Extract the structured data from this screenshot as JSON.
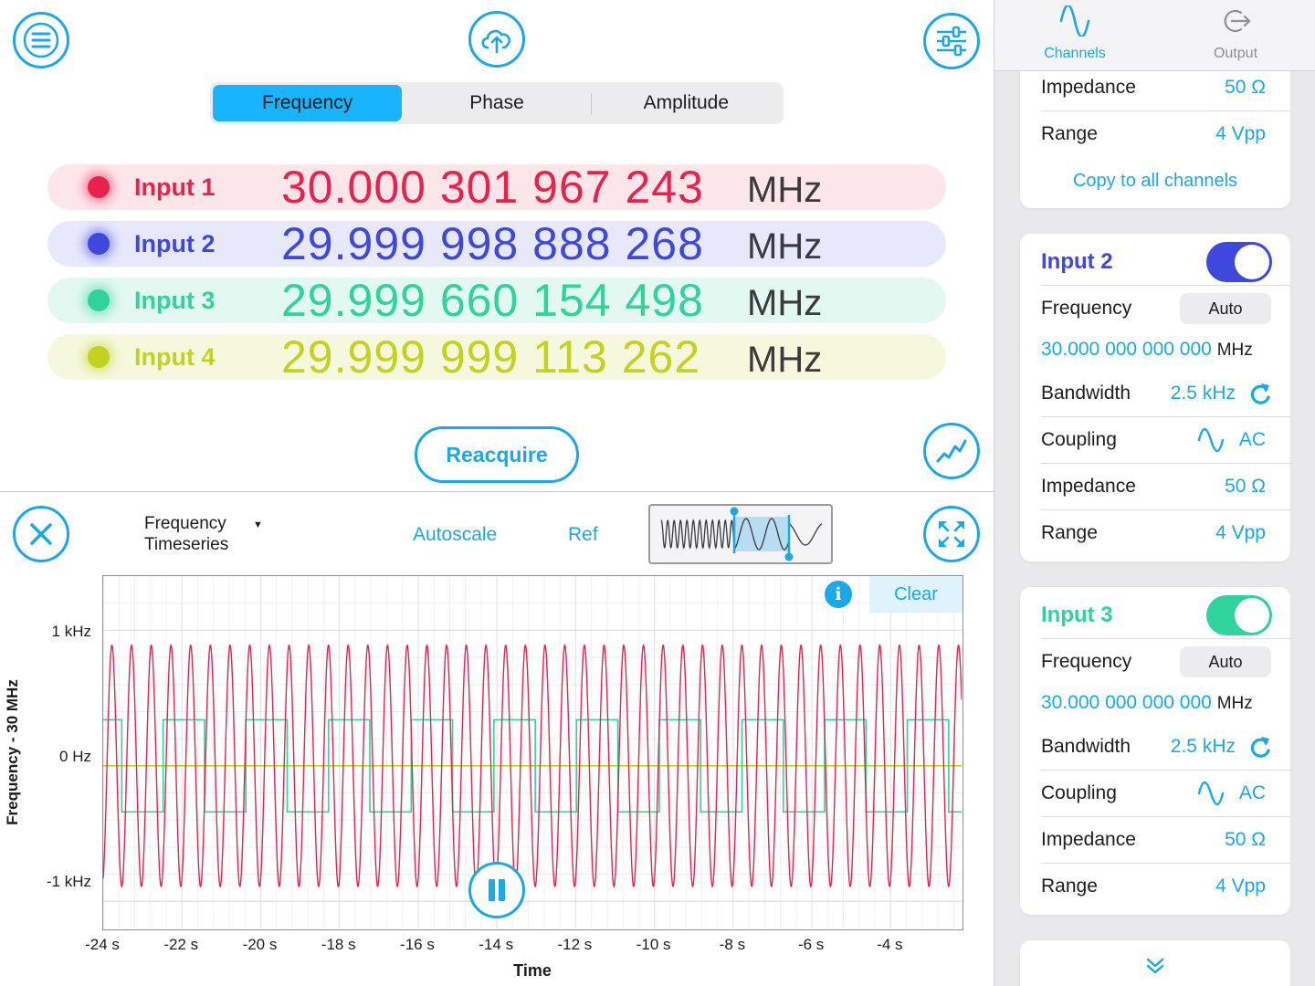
{
  "toolbar": {
    "menu_icon": "hamburger-icon",
    "upload_icon": "cloud-upload-icon",
    "settings_icon": "sliders-icon"
  },
  "mode_tabs": [
    {
      "label": "Frequency",
      "active": true
    },
    {
      "label": "Phase",
      "active": false
    },
    {
      "label": "Amplitude",
      "active": false
    }
  ],
  "readouts": [
    {
      "label": "Input 1",
      "value": "30.000 301 967 243",
      "unit": "MHz",
      "color": "#e8214d",
      "bg": "#fde6ea"
    },
    {
      "label": "Input 2",
      "value": "29.999 998 888 268",
      "unit": "MHz",
      "color": "#3e48dd",
      "bg": "#e7e8fb"
    },
    {
      "label": "Input 3",
      "value": "29.999 660 154 498",
      "unit": "MHz",
      "color": "#2fd39c",
      "bg": "#e2f8f0"
    },
    {
      "label": "Input 4",
      "value": "29.999 999 113 262",
      "unit": "MHz",
      "color": "#c3d21e",
      "bg": "#f5f8dc"
    }
  ],
  "reacquire_label": "Reacquire",
  "plot_toolbar": {
    "view_select": "Frequency\nTimeseries",
    "autoscale_label": "Autoscale",
    "ref_label": "Ref",
    "clear_label": "Clear",
    "info_label": "i"
  },
  "chart_data": {
    "type": "line",
    "xlabel": "Time",
    "ylabel": "Frequency - 30 MHz",
    "x_ticks": [
      "-24 s",
      "-22 s",
      "-20 s",
      "-18 s",
      "-16 s",
      "-14 s",
      "-12 s",
      "-10 s",
      "-8 s",
      "-6 s",
      "-4 s"
    ],
    "y_ticks": [
      "1 kHz",
      "0 Hz",
      "-1 kHz"
    ],
    "xlim": [
      -24,
      -2.2
    ],
    "ylim": [
      -1.2,
      1.4
    ],
    "y_unit": "kHz",
    "grid": true,
    "series": [
      {
        "shape": "sine",
        "color": "#e8214d",
        "amplitude": 0.89,
        "period_s": 0.5,
        "offset": 0
      },
      {
        "shape": "square",
        "color": "#2fd39c",
        "amplitude": 0.34,
        "period_s": 2.1,
        "offset": 0
      },
      {
        "shape": "flat",
        "color": "#c3d21e",
        "amplitude": 0,
        "offset": 0
      }
    ]
  },
  "side": {
    "tabs": [
      {
        "label": "Channels",
        "icon": "sine-wave-icon",
        "active": true
      },
      {
        "label": "Output",
        "icon": "output-arrow-icon",
        "active": false
      }
    ],
    "card0": {
      "rows": [
        {
          "k": "Impedance",
          "v": "50 Ω"
        },
        {
          "k": "Range",
          "v": "4 Vpp"
        }
      ],
      "copy_label": "Copy to all channels"
    },
    "cards": [
      {
        "title": "Input 2",
        "color": "#3e48dd",
        "enabled": true,
        "frequency_label": "Frequency",
        "frequency_mode": "Auto",
        "frequency_value": "30.000 000 000 000",
        "frequency_unit": "MHz",
        "bandwidth_label": "Bandwidth",
        "bandwidth_value": "2.5 kHz",
        "coupling_label": "Coupling",
        "coupling_value": "AC",
        "impedance_label": "Impedance",
        "impedance_value": "50 Ω",
        "range_label": "Range",
        "range_value": "4 Vpp"
      },
      {
        "title": "Input 3",
        "color": "#2fd39c",
        "enabled": true,
        "frequency_label": "Frequency",
        "frequency_mode": "Auto",
        "frequency_value": "30.000 000 000 000",
        "frequency_unit": "MHz",
        "bandwidth_label": "Bandwidth",
        "bandwidth_value": "2.5 kHz",
        "coupling_label": "Coupling",
        "coupling_value": "AC",
        "impedance_label": "Impedance",
        "impedance_value": "50 Ω",
        "range_label": "Range",
        "range_value": "4 Vpp"
      }
    ]
  },
  "colors": {
    "accent": "#1ba7e8",
    "segment_active": "#19b4ff"
  }
}
